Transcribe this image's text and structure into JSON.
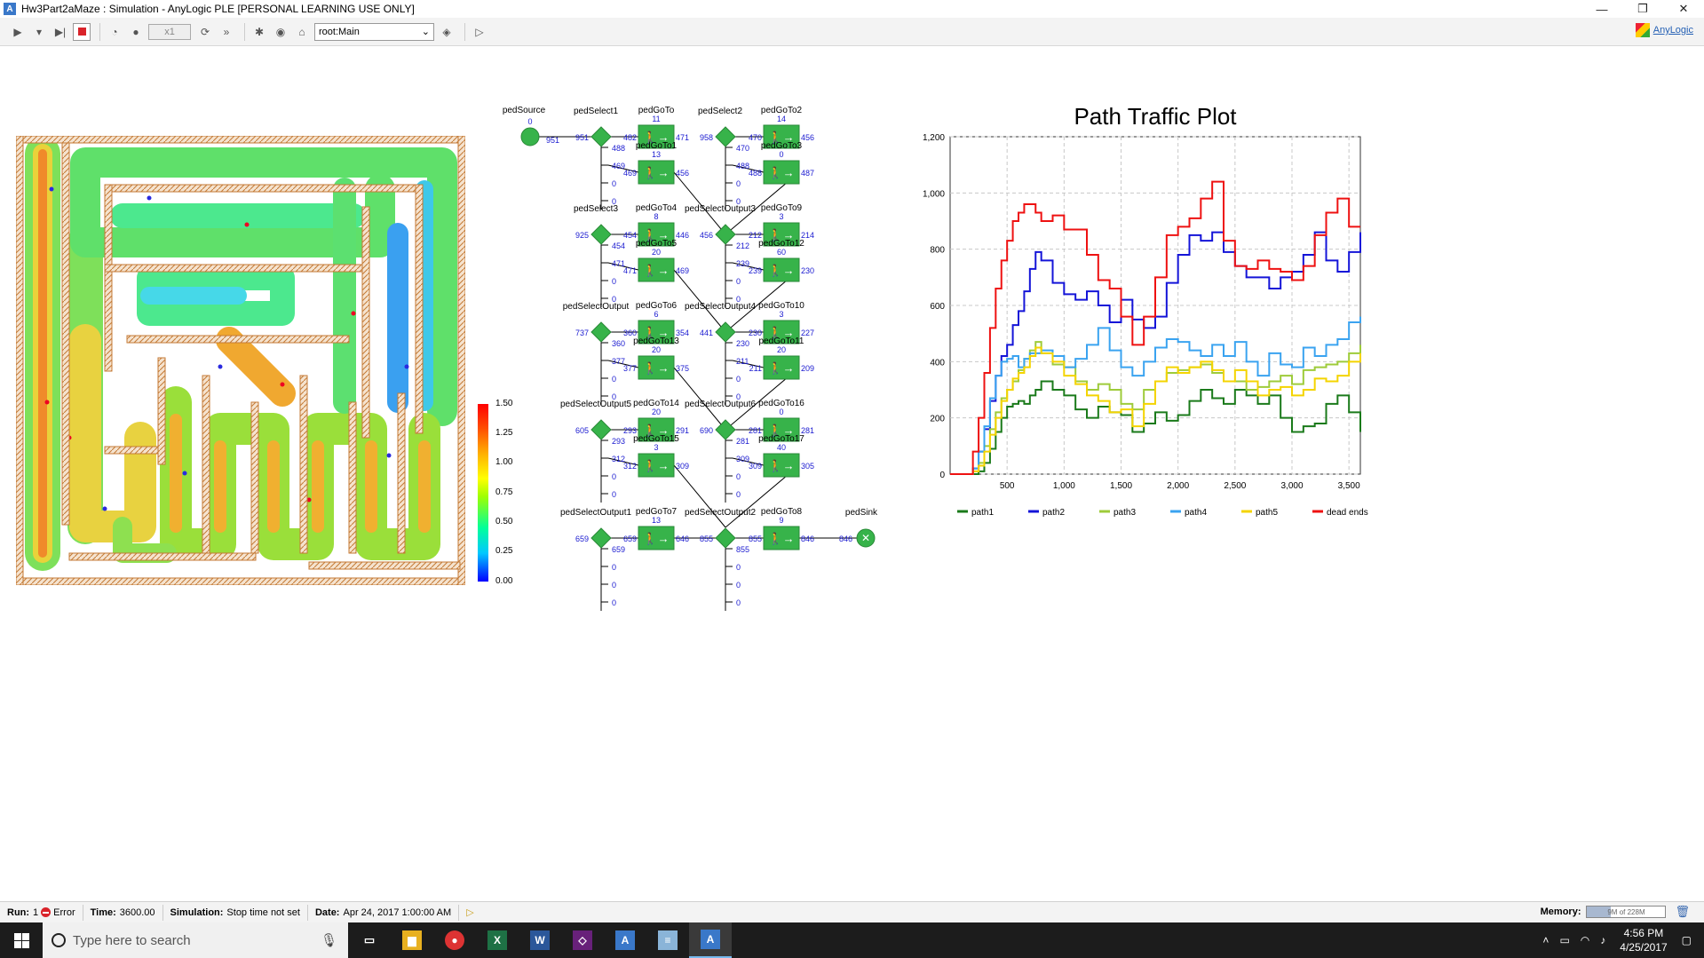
{
  "window": {
    "title": "Hw3Part2aMaze : Simulation - AnyLogic PLE [PERSONAL LEARNING USE ONLY]",
    "app_icon": "A",
    "minimize": "—",
    "restore": "❐",
    "close": "✕"
  },
  "toolbar": {
    "speed": "x1",
    "view_select": "root:Main",
    "logo_text": "AnyLogic"
  },
  "legend": {
    "labels": [
      "1.50",
      "1.25",
      "1.00",
      "0.75",
      "0.50",
      "0.25",
      "0.00"
    ]
  },
  "flowchart": {
    "blocks": [
      {
        "id": "pedSource",
        "label": "pedSource",
        "count": "0",
        "out": "951"
      },
      {
        "id": "pedSelect1",
        "label": "pedSelect1",
        "in": "951",
        "outs": [
          "488",
          "469",
          "0",
          "0"
        ]
      },
      {
        "id": "pedGoTo",
        "label": "pedGoTo",
        "top": "11",
        "in": "482",
        "out": "471"
      },
      {
        "id": "pedGoTo1",
        "label": "pedGoTo1",
        "top": "13",
        "in": "469",
        "out": "456"
      },
      {
        "id": "pedSelect2",
        "label": "pedSelect2",
        "in": "958",
        "outs": [
          "470",
          "488",
          "0",
          "0"
        ]
      },
      {
        "id": "pedGoTo2",
        "label": "pedGoTo2",
        "top": "14",
        "in": "470",
        "out": "456"
      },
      {
        "id": "pedGoTo3",
        "label": "pedGoTo3",
        "top": "0",
        "in": "488",
        "out": "487"
      },
      {
        "id": "pedSelect3",
        "label": "pedSelect3",
        "in": "925",
        "outs": [
          "454",
          "471",
          "0",
          "0"
        ]
      },
      {
        "id": "pedGoTo4",
        "label": "pedGoTo4",
        "top": "8",
        "in": "454",
        "out": "446"
      },
      {
        "id": "pedGoTo5",
        "label": "pedGoTo5",
        "top": "20",
        "in": "471",
        "out": "469"
      },
      {
        "id": "pedSelectOutput3",
        "label": "pedSelectOutput3",
        "in": "456",
        "outs": [
          "212",
          "239",
          "0",
          "0"
        ]
      },
      {
        "id": "pedGoTo9",
        "label": "pedGoTo9",
        "top": "3",
        "in": "212",
        "out": "214"
      },
      {
        "id": "pedGoTo12",
        "label": "pedGoTo12",
        "top": "60",
        "in": "239",
        "out": "230"
      },
      {
        "id": "pedSelectOutput",
        "label": "pedSelectOutput",
        "in": "737",
        "outs": [
          "360",
          "377",
          "0",
          "0"
        ]
      },
      {
        "id": "pedGoTo6",
        "label": "pedGoTo6",
        "top": "6",
        "in": "360",
        "out": "354"
      },
      {
        "id": "pedGoTo13",
        "label": "pedGoTo13",
        "top": "20",
        "in": "377",
        "out": "375"
      },
      {
        "id": "pedSelectOutput4",
        "label": "pedSelectOutput4",
        "in": "441",
        "outs": [
          "230",
          "211",
          "0",
          "0"
        ]
      },
      {
        "id": "pedGoTo10",
        "label": "pedGoTo10",
        "top": "3",
        "in": "230",
        "out": "227"
      },
      {
        "id": "pedGoTo11",
        "label": "pedGoTo11",
        "top": "20",
        "in": "211",
        "out": "209"
      },
      {
        "id": "pedSelectOutput5",
        "label": "pedSelectOutput5",
        "in": "605",
        "outs": [
          "293",
          "312",
          "0",
          "0"
        ]
      },
      {
        "id": "pedGoTo14",
        "label": "pedGoTo14",
        "top": "20",
        "in": "293",
        "out": "291"
      },
      {
        "id": "pedGoTo15",
        "label": "pedGoTo15",
        "top": "3",
        "in": "312",
        "out": "309"
      },
      {
        "id": "pedSelectOutput6",
        "label": "pedSelectOutput6",
        "in": "690",
        "outs": [
          "281",
          "309",
          "0",
          "0"
        ]
      },
      {
        "id": "pedGoTo16",
        "label": "pedGoTo16",
        "top": "0",
        "in": "281",
        "out": "281"
      },
      {
        "id": "pedGoTo17",
        "label": "pedGoTo17",
        "top": "40",
        "in": "309",
        "out": "305"
      },
      {
        "id": "pedSelectOutput1",
        "label": "pedSelectOutput1",
        "in": "659",
        "outs": [
          "659",
          "0",
          "0",
          "0"
        ]
      },
      {
        "id": "pedGoTo7",
        "label": "pedGoTo7",
        "top": "13",
        "in": "659",
        "out": "646"
      },
      {
        "id": "pedSelectOutput2",
        "label": "pedSelectOutput2",
        "in": "855",
        "outs": [
          "855",
          "0",
          "0",
          "0"
        ]
      },
      {
        "id": "pedGoTo8",
        "label": "pedGoTo8",
        "top": "9",
        "in": "855",
        "out": "846"
      },
      {
        "id": "pedSink",
        "label": "pedSink",
        "in": "846"
      }
    ]
  },
  "chart_data": {
    "type": "line",
    "title": "Path Traffic Plot",
    "xlim": [
      0,
      3600
    ],
    "ylim": [
      0,
      1200
    ],
    "xticks": [
      500,
      1000,
      1500,
      2000,
      2500,
      3000,
      3500
    ],
    "xtick_labels": [
      "500",
      "1,000",
      "1,500",
      "2,000",
      "2,500",
      "3,000",
      "3,500"
    ],
    "yticks": [
      0,
      200,
      400,
      600,
      800,
      1000,
      1200
    ],
    "ytick_labels": [
      "0",
      "200",
      "400",
      "600",
      "800",
      "1,000",
      "1,200"
    ],
    "grid": true,
    "legend_position": "bottom",
    "x": [
      0,
      150,
      200,
      250,
      300,
      350,
      400,
      450,
      500,
      550,
      600,
      650,
      700,
      750,
      800,
      900,
      1000,
      1100,
      1200,
      1300,
      1400,
      1500,
      1600,
      1700,
      1800,
      1900,
      2000,
      2100,
      2200,
      2300,
      2400,
      2500,
      2600,
      2700,
      2800,
      2900,
      3000,
      3100,
      3200,
      3300,
      3400,
      3500,
      3600
    ],
    "series": [
      {
        "name": "path1",
        "color": "#1a7a1a",
        "values": [
          0,
          0,
          0,
          10,
          40,
          90,
          150,
          200,
          240,
          250,
          260,
          250,
          280,
          300,
          330,
          300,
          280,
          230,
          200,
          240,
          220,
          210,
          150,
          180,
          220,
          190,
          210,
          260,
          300,
          270,
          250,
          300,
          280,
          250,
          280,
          200,
          150,
          170,
          180,
          250,
          280,
          220,
          150
        ]
      },
      {
        "name": "path2",
        "color": "#1414d8",
        "values": [
          0,
          0,
          20,
          80,
          160,
          260,
          350,
          420,
          460,
          530,
          580,
          650,
          730,
          790,
          760,
          680,
          640,
          620,
          650,
          600,
          540,
          620,
          550,
          520,
          560,
          680,
          780,
          850,
          830,
          860,
          790,
          740,
          700,
          700,
          660,
          700,
          720,
          780,
          860,
          760,
          720,
          790,
          860
        ]
      },
      {
        "name": "path3",
        "color": "#9ecb3a",
        "values": [
          0,
          0,
          10,
          40,
          100,
          160,
          220,
          270,
          300,
          330,
          370,
          410,
          440,
          470,
          430,
          390,
          380,
          330,
          300,
          320,
          300,
          250,
          230,
          300,
          330,
          360,
          370,
          380,
          390,
          360,
          330,
          330,
          300,
          310,
          330,
          350,
          320,
          370,
          380,
          390,
          400,
          430,
          460
        ]
      },
      {
        "name": "path4",
        "color": "#3aa3f0",
        "values": [
          0,
          0,
          20,
          80,
          170,
          270,
          350,
          400,
          410,
          420,
          380,
          410,
          430,
          430,
          440,
          420,
          380,
          410,
          460,
          520,
          440,
          380,
          350,
          400,
          450,
          480,
          470,
          440,
          420,
          460,
          420,
          470,
          400,
          350,
          430,
          390,
          380,
          450,
          420,
          460,
          480,
          540,
          560
        ]
      },
      {
        "name": "path5",
        "color": "#f4d400",
        "values": [
          0,
          0,
          10,
          30,
          80,
          140,
          200,
          260,
          300,
          340,
          360,
          380,
          420,
          450,
          430,
          400,
          350,
          320,
          280,
          260,
          220,
          230,
          170,
          250,
          330,
          380,
          360,
          380,
          400,
          370,
          330,
          370,
          330,
          280,
          300,
          310,
          280,
          300,
          340,
          330,
          350,
          400,
          430
        ]
      },
      {
        "name": "dead ends",
        "color": "#ee1111",
        "values": [
          0,
          0,
          80,
          200,
          360,
          520,
          660,
          760,
          830,
          900,
          930,
          960,
          960,
          930,
          900,
          920,
          870,
          870,
          780,
          690,
          660,
          560,
          460,
          560,
          700,
          850,
          880,
          910,
          980,
          1040,
          830,
          740,
          730,
          760,
          730,
          720,
          690,
          740,
          850,
          930,
          980,
          880,
          880
        ]
      }
    ]
  },
  "statusbar": {
    "run_label": "Run:",
    "run_value": "1",
    "error": "Error",
    "time_label": "Time:",
    "time_value": "3600.00",
    "sim_label": "Simulation:",
    "sim_value": "Stop time not set",
    "date_label": "Date:",
    "date_value": "Apr 24, 2017 1:00:00 AM",
    "memory_label": "Memory:",
    "memory_value": "9M of 228M",
    "memory_fraction": 0.3
  },
  "taskbar": {
    "search_placeholder": "Type here to search",
    "time": "4:56 PM",
    "date": "4/25/2017"
  }
}
